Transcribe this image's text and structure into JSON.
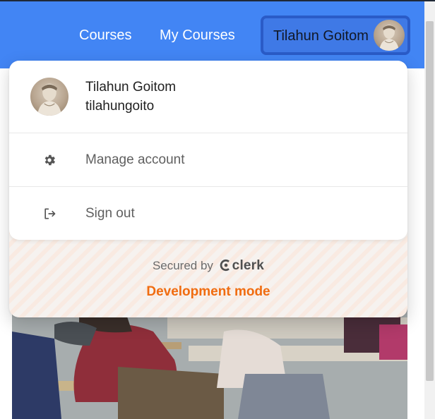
{
  "nav": {
    "links": [
      {
        "label": "Courses"
      },
      {
        "label": "My Courses"
      }
    ],
    "user_button": {
      "name": "Tilahun Goitom"
    }
  },
  "popover": {
    "profile": {
      "name": "Tilahun Goitom",
      "username": "tilahungoito"
    },
    "menu": [
      {
        "label": "Manage account",
        "icon": "gear-icon"
      },
      {
        "label": "Sign out",
        "icon": "sign-out-icon"
      }
    ],
    "footer": {
      "secured_by": "Secured by",
      "brand": "clerk",
      "mode": "Development mode"
    }
  },
  "colors": {
    "navbar": "#4285f4",
    "dev_mode": "#f06c10"
  }
}
